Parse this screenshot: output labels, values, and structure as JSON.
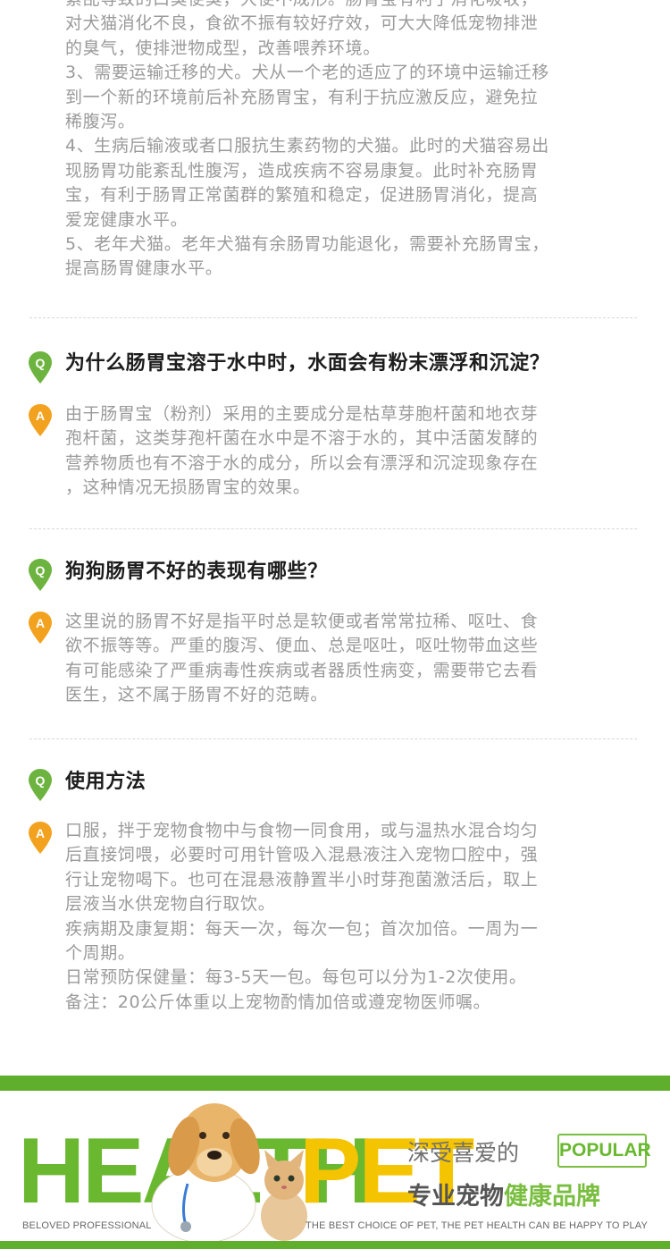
{
  "sections": {
    "top": {
      "lines": [
        "紊乱等致的口臭便臭，大便不成形。肠胃宝有利于消化吸收，",
        "对犬猫消化不良，食欲不振有较好疗效，可大大降低宠物排泄",
        "的臭气，使排泄物成型，改善喂养环境。",
        "3、需要运输迁移的犬。犬从一个老的适应了的环境中运输迁移",
        "到一个新的环境前后补充肠胃宝，有利于抗应激反应，避免拉",
        "稀腹泻。",
        "4、生病后输液或者口服抗生素药物的犬猫。此时的犬猫容易出",
        "现肠胃功能紊乱性腹泻，造成疾病不容易康复。此时补充肠胃",
        "宝，有利于肠胃正常菌群的繁殖和稳定，促进肠胃消化，提高",
        "爱宠健康水平。",
        "5、老年犬猫。老年犬猫有余肠胃功能退化，需要补充肠胃宝，",
        "提高肠胃健康水平。"
      ]
    },
    "qa": [
      {
        "q_badge": "Q",
        "a_badge": "A",
        "question": "为什么肠胃宝溶于水中时，水面会有粉末漂浮和沉淀？",
        "answer_lines": [
          "由于肠胃宝（粉剂）采用的主要成分是枯草芽胞杆菌和地衣芽",
          "孢杆菌，这类芽孢杆菌在水中是不溶于水的，其中活菌发酵的",
          "营养物质也有不溶于水的成分，所以会有漂浮和沉淀现象存在",
          "，这种情况无损肠胃宝的效果。"
        ]
      },
      {
        "q_badge": "Q",
        "a_badge": "A",
        "question": "狗狗肠胃不好的表现有哪些？",
        "answer_lines": [
          "这里说的肠胃不好是指平时总是软便或者常常拉稀、呕吐、食",
          "欲不振等等。严重的腹泻、便血、总是呕吐，呕吐物带血这些",
          "有可能感染了严重病毒性疾病或者器质性病变，需要带它去看",
          "医生，这不属于肠胃不好的范畴。"
        ]
      },
      {
        "q_badge": "Q",
        "a_badge": "A",
        "question": "使用方法",
        "answer_lines": [
          "口服，拌于宠物食物中与食物一同食用，或与温热水混合均匀",
          "后直接饲喂，必要时可用针管吸入混悬液注入宠物口腔中，强",
          "行让宠物喝下。也可在混悬液静置半小时芽孢菌激活后，取上",
          "层液当水供宠物自行取饮。",
          "疾病期及康复期：每天一次，每次一包；首次加倍。一周为一",
          "个周期。",
          "日常预防保健量：每3-5天一包。每包可以分为1-2次使用。",
          "备注：20公斤体重以上宠物酌情加倍或遵宠物医师嘱。"
        ]
      }
    ]
  },
  "banner": {
    "word_health": "HEALTH",
    "word_pet": "PET",
    "slogan": "深受喜爱的",
    "popular": "POPULAR",
    "brand_part1": "专业宠物",
    "brand_part2": "健康品牌",
    "tagline_left": "BELOVED PROFESSIONAL",
    "tagline_right": "THE BEST CHOICE OF PET, THE PET HEALTH CAN BE HAPPY TO PLAY"
  },
  "colors": {
    "green": "#5fae2c",
    "badge_q": "#6db33f",
    "badge_a": "#f3a21f",
    "yellow": "#f5c400",
    "body_text": "#9a9a9a",
    "heading_text": "#1c1c1c"
  },
  "icons": {
    "question_badge": "q-pin-icon",
    "answer_badge": "a-pin-icon",
    "pets": "dog-and-cat-illustration"
  }
}
